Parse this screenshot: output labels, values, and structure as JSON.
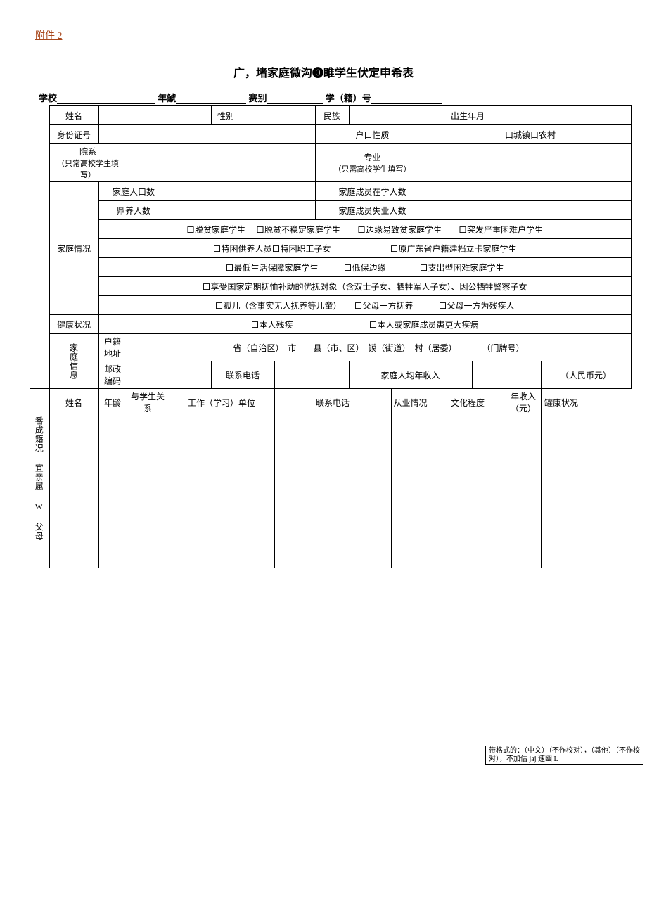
{
  "attachment": "附件 2",
  "title": "广，堵家庭微沟⓿睢学生伏定申希表",
  "header": {
    "school": "学校",
    "grade_class": "年鯱",
    "proj": "赛别",
    "id": "学（籍）号"
  },
  "rows": {
    "name": "姓名",
    "sex": "性别",
    "nation": "民族",
    "dob": "出生年月",
    "idno": "身份证号",
    "hukou": "户口性质",
    "hukou_opts": "口城镇口农村",
    "dept": "院系",
    "dept_sub": "（只常高校学生填写）",
    "major": "专业",
    "major_sub": "（只需高校学生填写）",
    "fam_situation": "家庭情况",
    "fam_pop": "家庭人口数",
    "fam_instudy": "家庭成员在学人数",
    "raise": "鼎养人数",
    "fam_unemploy": "家庭成员失业人数",
    "opt1": "口脱贫家庭学生　 口脱贫不稳定家庭学生　　口边缘易致贫家庭学生　　口突发严重困难户学生",
    "opt2": "口特困供养人员口特困职工子女　　　　　　　口原广东省户籍建档立卡家庭学生",
    "opt3": "口最低生活保障家庭学生　　　口低保边缘　　　　口支出型困难家庭学生",
    "opt4": "口享受国家定期抚恤补助的优抚对象（含双士子女、牺牲军人子女）、因公牺牲警察子女",
    "opt5": "口孤儿（含事实无人抚养等儿童）　　口父母一方抚养　　　口父母一方为残疾人",
    "health": "健康状况",
    "health_opts": "口本人残疾　　　　　　　　　口本人或家庭成员患更大疾病",
    "side_faminfo": "家庭信息",
    "addr": "户籍地址",
    "addr_tpl": "省（自治区）　市　　县（市、区）　馍（街道）　村（居委）　　　　（门牌号）",
    "post": "邮政编码",
    "tel": "联系电话",
    "fam_income": "家庭人均年收入",
    "rmb": "（人民币元）",
    "side_members": "番成籍况 宜亲属 W 父母",
    "m_name": "姓名",
    "m_age": "年龄",
    "m_rel": "与学生关系",
    "m_unit": "工作（学习）单位",
    "m_tel": "联系电话",
    "m_job": "从业情况",
    "m_edu": "文化程度",
    "m_income": "年收入（元）",
    "m_health": "罐康状况"
  },
  "format_note": "带格式的：（中文）（不作校对），（其他）（不作校对），不加估 jaj 速幽 L"
}
